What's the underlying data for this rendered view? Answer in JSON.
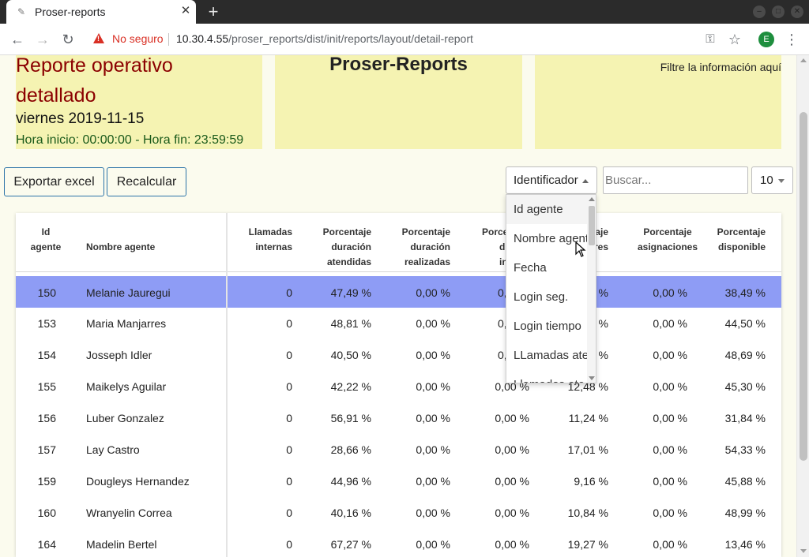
{
  "browser": {
    "tab_title": "Proser-reports",
    "new_tab": "+",
    "insecure_label": "No seguro",
    "url_host": "10.30.4.55",
    "url_path": "/proser_reports/dist/init/reports/layout/detail-report",
    "profile_initial": "E"
  },
  "header": {
    "title": "Reporte operativo detallado",
    "date": "viernes 2019-11-15",
    "hours": "Hora inicio: 00:00:00 - Hora fin: 23:59:59",
    "brand": "Proser-Reports",
    "filter_hint": "Filtre la información aquí"
  },
  "toolbar": {
    "export_label": "Exportar excel",
    "recalc_label": "Recalcular",
    "filter_field_value": "Identificador",
    "search_placeholder": "Buscar...",
    "page_size": "10"
  },
  "dropdown": {
    "options": [
      "Id agente",
      "Nombre agente",
      "Fecha",
      "Login seg.",
      "Login tiempo",
      "LLamadas ate",
      "Llamadas ate"
    ]
  },
  "table": {
    "headers": {
      "id": [
        "Id",
        "agente"
      ],
      "name": [
        "Nombre agente"
      ],
      "internal": [
        "Llamadas",
        "internas"
      ],
      "attended": [
        "Porcentaje",
        "duración",
        "atendidas"
      ],
      "made": [
        "Porcentaje",
        "duración",
        "realizadas"
      ],
      "internal_pct_partial": [
        "Porce",
        "du",
        "int"
      ],
      "breaks_partial": [
        "aje",
        "res"
      ],
      "assignments": [
        "Porcentaje",
        "asignaciones"
      ],
      "available": [
        "Porcentaje",
        "disponible"
      ]
    },
    "rows": [
      {
        "id": "150",
        "name": "Melanie Jauregui",
        "internal": "0",
        "attended": "47,49 %",
        "made": "0,00 %",
        "internal_pct": "0,",
        "breaks": "%",
        "assign": "0,00 %",
        "avail": "38,49 %"
      },
      {
        "id": "153",
        "name": "Maria Manjarres",
        "internal": "0",
        "attended": "48,81 %",
        "made": "0,00 %",
        "internal_pct": "0,",
        "breaks": "%",
        "assign": "0,00 %",
        "avail": "44,50 %"
      },
      {
        "id": "154",
        "name": "Josseph Idler",
        "internal": "0",
        "attended": "40,50 %",
        "made": "0,00 %",
        "internal_pct": "0,",
        "breaks": "%",
        "assign": "0,00 %",
        "avail": "48,69 %"
      },
      {
        "id": "155",
        "name": "Maikelys Aguilar",
        "internal": "0",
        "attended": "42,22 %",
        "made": "0,00 %",
        "internal_pct": "0,00 %",
        "breaks": "12,48 %",
        "assign": "0,00 %",
        "avail": "45,30 %"
      },
      {
        "id": "156",
        "name": "Luber Gonzalez",
        "internal": "0",
        "attended": "56,91 %",
        "made": "0,00 %",
        "internal_pct": "0,00 %",
        "breaks": "11,24 %",
        "assign": "0,00 %",
        "avail": "31,84 %"
      },
      {
        "id": "157",
        "name": "Lay Castro",
        "internal": "0",
        "attended": "28,66 %",
        "made": "0,00 %",
        "internal_pct": "0,00 %",
        "breaks": "17,01 %",
        "assign": "0,00 %",
        "avail": "54,33 %"
      },
      {
        "id": "159",
        "name": "Dougleys Hernandez",
        "internal": "0",
        "attended": "44,96 %",
        "made": "0,00 %",
        "internal_pct": "0,00 %",
        "breaks": "9,16 %",
        "assign": "0,00 %",
        "avail": "45,88 %"
      },
      {
        "id": "160",
        "name": "Wranyelin Correa",
        "internal": "0",
        "attended": "40,16 %",
        "made": "0,00 %",
        "internal_pct": "0,00 %",
        "breaks": "10,84 %",
        "assign": "0,00 %",
        "avail": "48,99 %"
      },
      {
        "id": "164",
        "name": "Madelin Bertel",
        "internal": "0",
        "attended": "67,27 %",
        "made": "0,00 %",
        "internal_pct": "0,00 %",
        "breaks": "19,27 %",
        "assign": "0,00 %",
        "avail": "13,46 %"
      }
    ]
  },
  "colors": {
    "title_red": "#8b0000",
    "panel_yellow": "#f5f3b2",
    "selected_row": "#8e9cf5",
    "button_border": "#2d74a8"
  }
}
